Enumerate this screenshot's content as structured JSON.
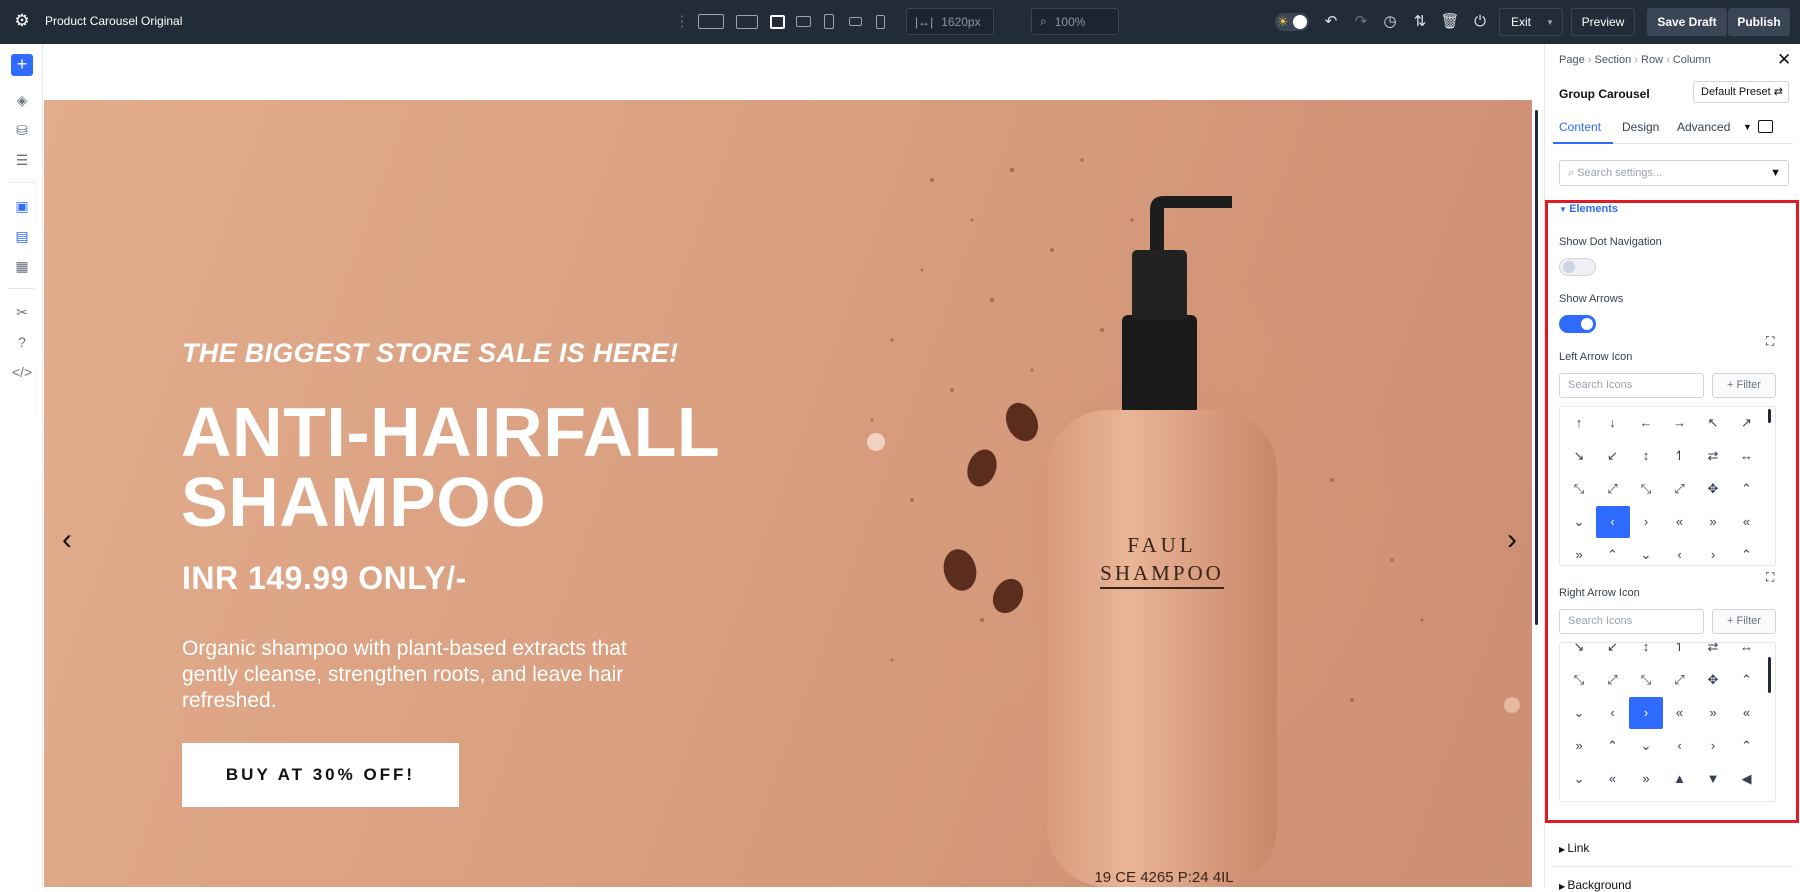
{
  "topbar": {
    "title": "Product Carousel Original",
    "width_value": "1620px",
    "zoom_value": "100%",
    "exit_label": "Exit",
    "preview_label": "Preview",
    "save_draft_label": "Save Draft",
    "publish_label": "Publish"
  },
  "hero": {
    "subheading": "THE BIGGEST STORE SALE IS HERE!",
    "headline_line1": "ANTI-HAIRFALL",
    "headline_line2": "SHAMPOO",
    "price": "INR 149.99 ONLY/-",
    "description": "Organic shampoo with plant-based extracts that gently cleanse, strengthen roots, and leave hair refreshed.",
    "cta_label": "BUY AT 30% OFF!",
    "bottle_label_line1": "FAUL",
    "bottle_label_line2": "SHAMPOO",
    "bottle_code": "19 CE 4265 P:24 4IL"
  },
  "panel": {
    "breadcrumb": [
      "Page",
      "Section",
      "Row",
      "Column"
    ],
    "module_name": "Group Carousel",
    "preset_label": "Default Preset",
    "tabs": [
      "Content",
      "Design",
      "Advanced"
    ],
    "search_placeholder": "Search settings...",
    "elements_section": "Elements",
    "show_dot_navigation": "Show Dot Navigation",
    "show_arrows": "Show Arrows",
    "left_arrow_icon": "Left Arrow Icon",
    "right_arrow_icon": "Right Arrow Icon",
    "icon_search_placeholder": "Search Icons",
    "filter_label": "Filter",
    "link_section": "Link",
    "background_section": "Background",
    "dot_navigation_on": false,
    "arrows_on": true,
    "left_grid_icons": [
      "↑",
      "↓",
      "←",
      "→",
      "↖",
      "↗",
      "↘",
      "↙",
      "↕",
      "↿",
      "⇄",
      "↔",
      "⤡",
      "⤢",
      "⤡",
      "⤢",
      "✥",
      "⌃",
      "⌄",
      "‹",
      "›",
      "«",
      "»",
      "«",
      "»",
      "⌃",
      "⌄",
      "‹",
      "›",
      "⌃"
    ],
    "right_grid_icons": [
      "↘",
      "↙",
      "↕",
      "↿",
      "⇄",
      "↔",
      "⤡",
      "⤢",
      "⤡",
      "⤢",
      "✥",
      "⌃",
      "⌄",
      "‹",
      "›",
      "«",
      "»",
      "«",
      "»",
      "⌃",
      "⌄",
      "‹",
      "›",
      "⌃",
      "⌄",
      "«",
      "»",
      "▲",
      "▼",
      "◀"
    ]
  },
  "colors": {
    "accent": "#2f6bff",
    "topbar": "#222b38",
    "highlight": "#e01b24",
    "hero_bg": "#d99f80"
  }
}
